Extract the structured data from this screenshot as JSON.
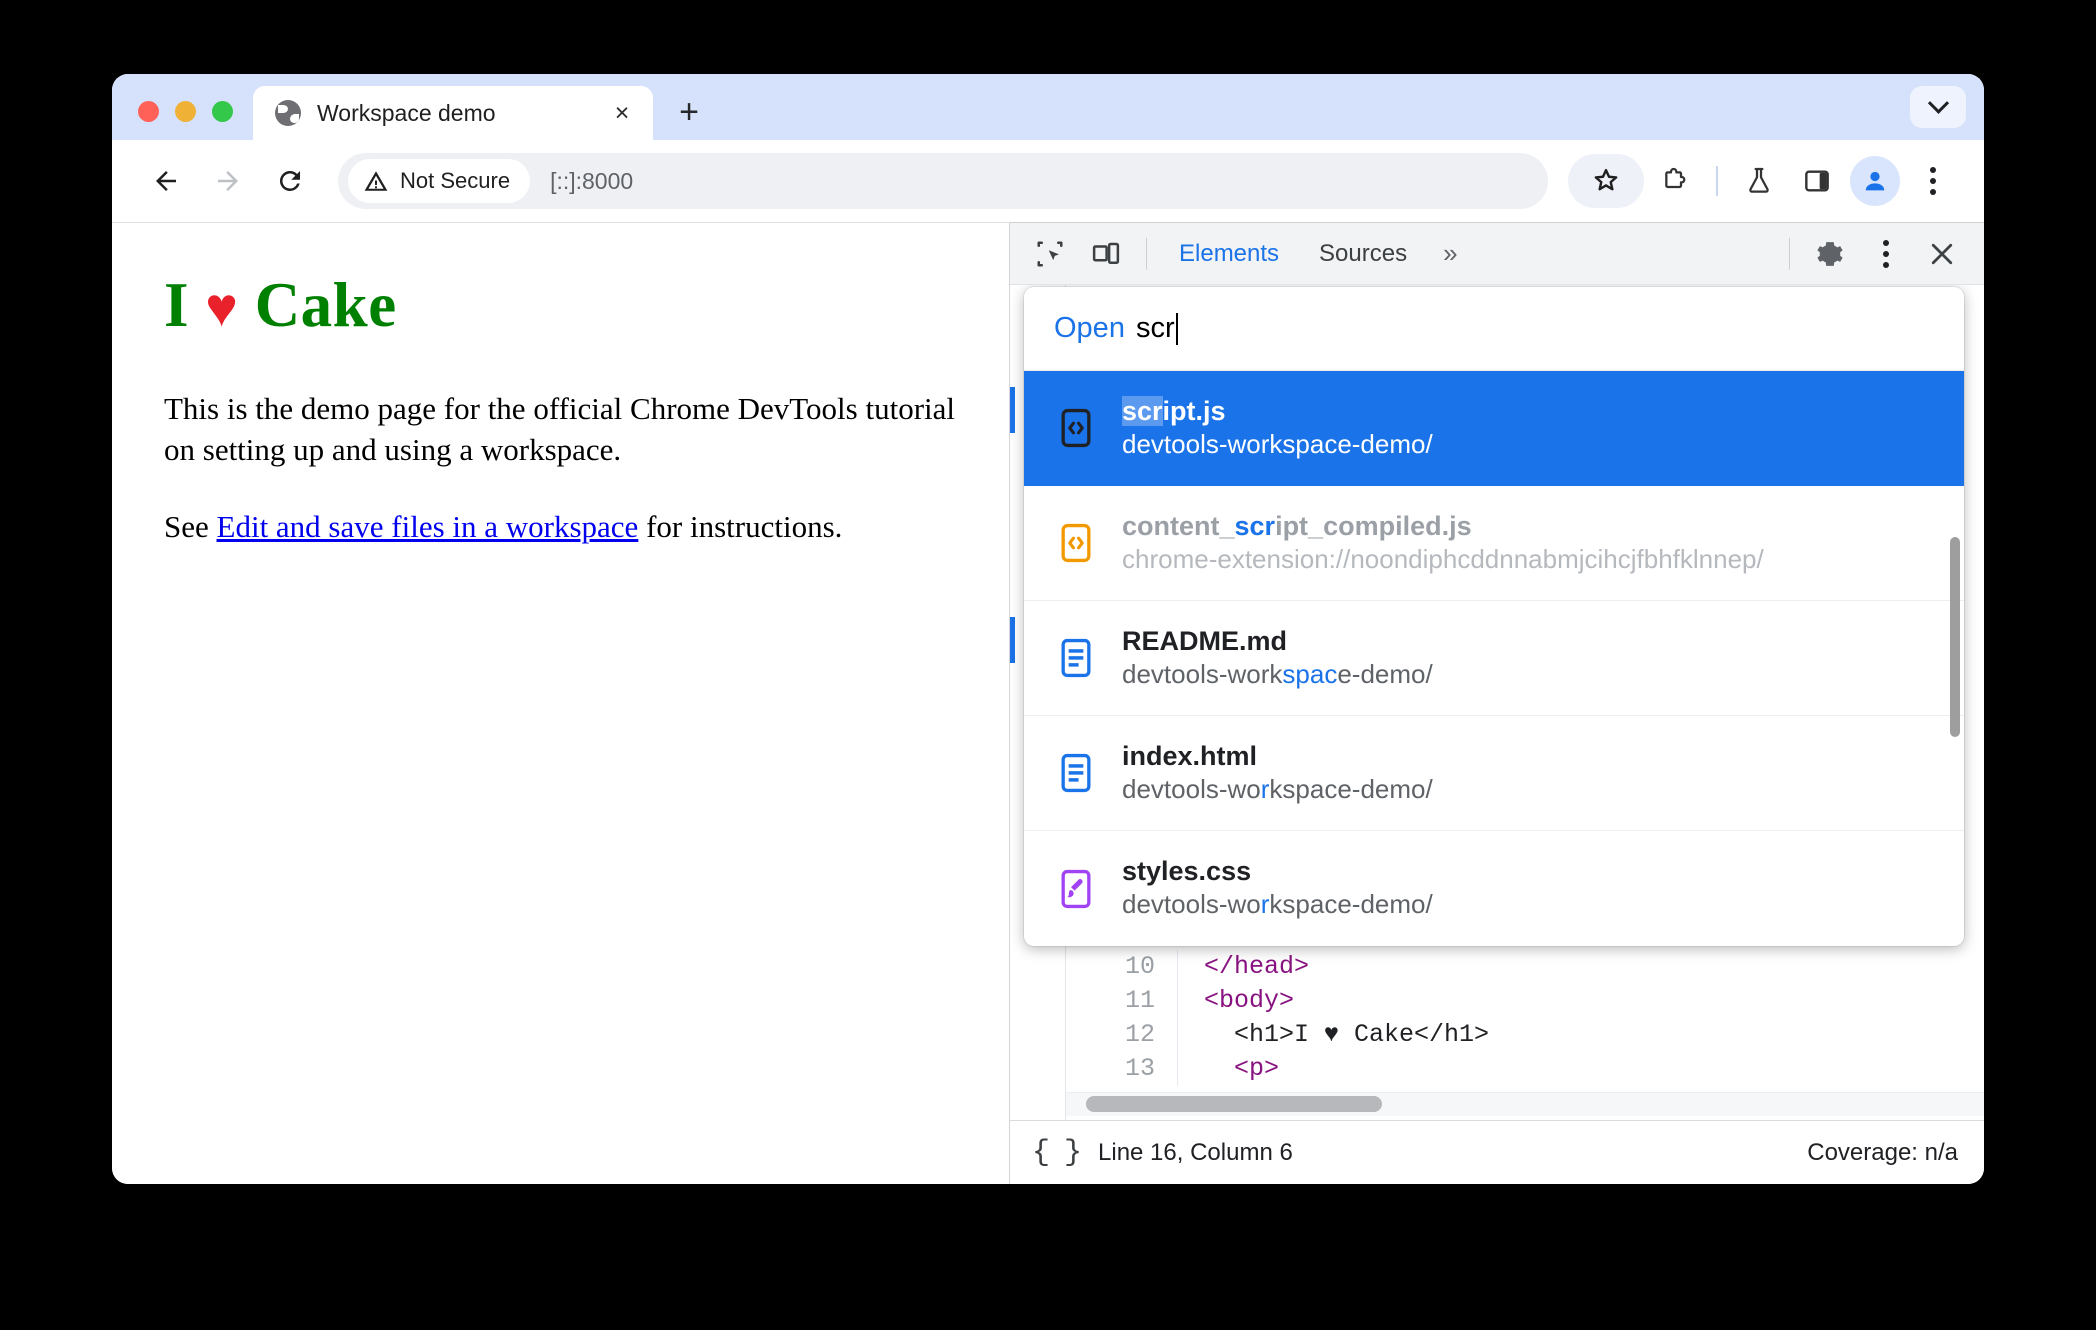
{
  "browser": {
    "tab": {
      "title": "Workspace demo",
      "favicon": "globe-icon",
      "close": "×"
    },
    "new_tab_label": "+",
    "tab_search": "chevron-down-icon",
    "omnibox": {
      "security_label": "Not Secure",
      "security_icon": "warning-triangle-icon",
      "url": "[::]:8000"
    },
    "actions": {
      "back": "back-arrow-icon",
      "forward": "forward-arrow-icon",
      "reload": "reload-icon",
      "bookmark": "star-icon",
      "extensions": "puzzle-piece-icon",
      "labs": "flask-icon",
      "side_panel": "side-panel-icon",
      "profile": "profile-avatar-icon",
      "menu": "three-dot-menu-icon"
    }
  },
  "page": {
    "heading_prefix": "I",
    "heading_heart": "♥",
    "heading_suffix": "Cake",
    "paragraph1": "This is the demo page for the official Chrome DevTools tutorial on setting up and using a workspace.",
    "paragraph2_before": "See ",
    "link_text": "Edit and save files in a workspace",
    "paragraph2_after": " for instructions."
  },
  "devtools": {
    "toolbar": {
      "inspect": "inspect-element-icon",
      "device": "device-toolbar-icon",
      "tabs": [
        {
          "label": "Elements",
          "active": true
        },
        {
          "label": "Sources",
          "active": false
        }
      ],
      "overflow": "»",
      "settings": "gear-icon",
      "more": "three-dot-menu-icon",
      "close": "close-icon"
    },
    "palette": {
      "prefix": "Open",
      "query": "scr",
      "items": [
        {
          "icon": "js-file-icon",
          "title_pre": "",
          "title_hl": "scr",
          "title_post": "ipt.js",
          "sub_parts": [
            {
              "t": "devtools-workspace-demo/",
              "hl": false
            }
          ],
          "selected": true,
          "dim": false
        },
        {
          "icon": "js-file-icon-orange",
          "title_pre": "content_",
          "title_hl": "scr",
          "title_post": "ipt_compiled.js",
          "sub_parts": [
            {
              "t": "chrome-extension://noondiphcddnnabmjcihcjfbhfklnnep/",
              "hl": false
            }
          ],
          "selected": false,
          "dim": true
        },
        {
          "icon": "document-file-icon",
          "title_pre": "README.md",
          "title_hl": "",
          "title_post": "",
          "sub_parts": [
            {
              "t": "devtools-work",
              "hl": false
            },
            {
              "t": "s",
              "hl": true
            },
            {
              "t": "pa",
              "hl": true
            },
            {
              "t": "c",
              "hl": true
            },
            {
              "t": "e-demo/",
              "hl": false
            }
          ],
          "selected": false,
          "dim": false
        },
        {
          "icon": "document-file-icon",
          "title_pre": "index.html",
          "title_hl": "",
          "title_post": "",
          "sub_parts": [
            {
              "t": "devtools-wo",
              "hl": false
            },
            {
              "t": "r",
              "hl": true
            },
            {
              "t": "kspace-demo/",
              "hl": false
            }
          ],
          "selected": false,
          "dim": false
        },
        {
          "icon": "css-file-icon",
          "title_pre": "styles.css",
          "title_hl": "",
          "title_post": "",
          "sub_parts": [
            {
              "t": "devtools-wo",
              "hl": false
            },
            {
              "t": "r",
              "hl": true
            },
            {
              "t": "kspace-demo/",
              "hl": false
            }
          ],
          "selected": false,
          "dim": false
        }
      ]
    },
    "editor": {
      "lines": [
        {
          "num": "10",
          "code": "</head>"
        },
        {
          "num": "11",
          "code": "<body>"
        },
        {
          "num": "12",
          "code": "  <h1>I ♥ Cake</h1>"
        },
        {
          "num": "13",
          "code": "  <p>"
        }
      ]
    },
    "status": {
      "format_icon": "pretty-print-braces-icon",
      "position": "Line 16, Column 6",
      "coverage": "Coverage: n/a"
    }
  },
  "colors": {
    "accent_blue": "#1a73e8",
    "tabstrip": "#d6e2fb",
    "heading_green": "#008000",
    "heart_red": "#e8212a",
    "link_blue": "#0000ee"
  }
}
